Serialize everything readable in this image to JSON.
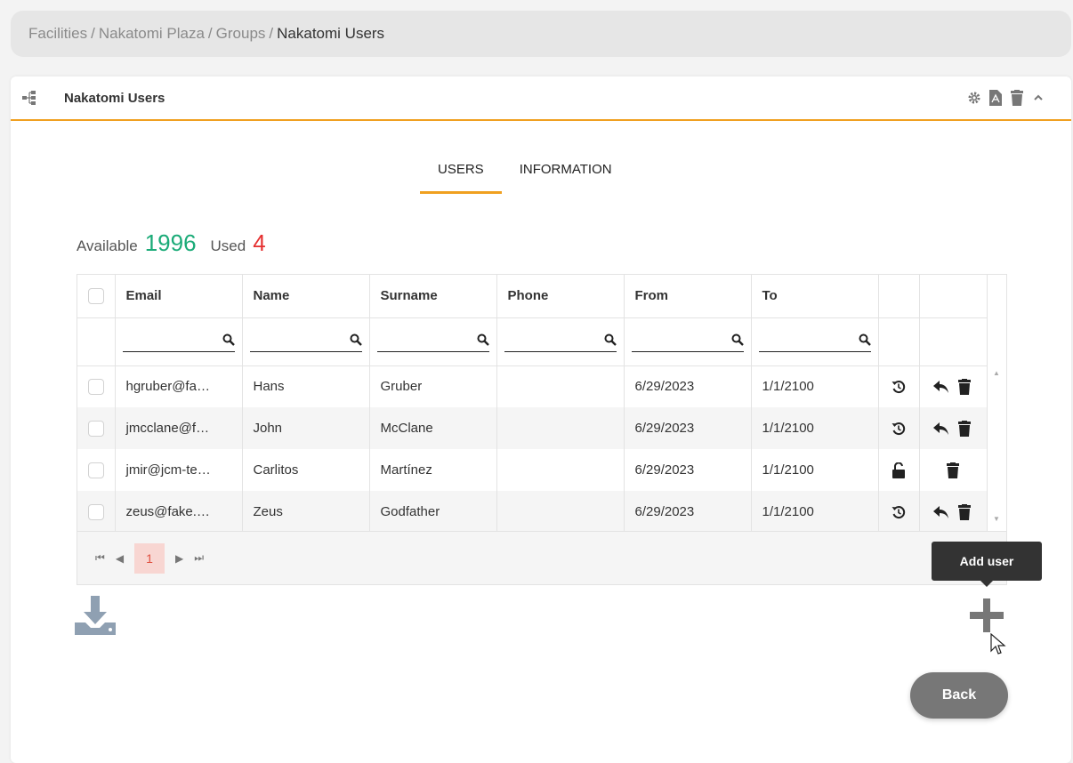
{
  "breadcrumb": {
    "items": [
      "Facilities",
      "Nakatomi Plaza",
      "Groups"
    ],
    "separator": "/",
    "current": "Nakatomi Users"
  },
  "panel": {
    "title": "Nakatomi Users",
    "tool_icons": [
      "gear-icon",
      "pdf-icon",
      "trash-icon",
      "chevron-up-icon"
    ]
  },
  "tabs": [
    {
      "label": "USERS",
      "active": true
    },
    {
      "label": "INFORMATION",
      "active": false
    }
  ],
  "counts": {
    "available_label": "Available",
    "available_value": "1996",
    "used_label": "Used",
    "used_value": "4",
    "available_color": "#1bab78",
    "used_color": "#e53030"
  },
  "table": {
    "columns": [
      "Email",
      "Name",
      "Surname",
      "Phone",
      "From",
      "To"
    ],
    "rows": [
      {
        "email": "hgruber@fa…",
        "name": "Hans",
        "surname": "Gruber",
        "phone": "",
        "from": "6/29/2023",
        "to": "1/1/2100",
        "status_icon": "history-icon",
        "actions": [
          "reply-icon",
          "trash-icon"
        ]
      },
      {
        "email": "jmcclane@f…",
        "name": "John",
        "surname": "McClane",
        "phone": "",
        "from": "6/29/2023",
        "to": "1/1/2100",
        "status_icon": "history-icon",
        "actions": [
          "reply-icon",
          "trash-icon"
        ]
      },
      {
        "email": "jmir@jcm-te…",
        "name": "Carlitos",
        "surname": "Martínez",
        "phone": "",
        "from": "6/29/2023",
        "to": "1/1/2100",
        "status_icon": "unlock-icon",
        "actions": [
          "trash-icon"
        ]
      },
      {
        "email": "zeus@fake.…",
        "name": "Zeus",
        "surname": "Godfather",
        "phone": "",
        "from": "6/29/2023",
        "to": "1/1/2100",
        "status_icon": "history-icon",
        "actions": [
          "reply-icon",
          "trash-icon"
        ]
      }
    ]
  },
  "pager": {
    "current_page": "1"
  },
  "tooltip": "Add user",
  "back_label": "Back",
  "accent_color": "#f0a020"
}
